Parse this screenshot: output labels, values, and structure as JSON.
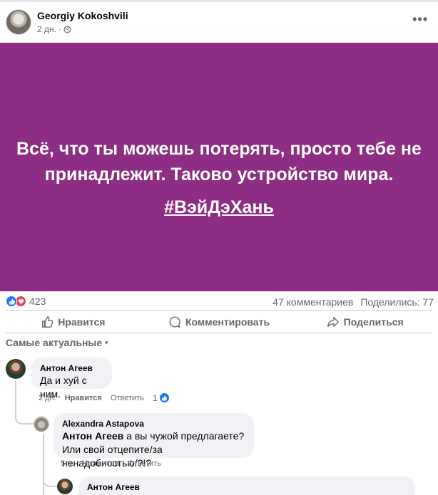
{
  "post": {
    "author": "Georgiy Kokoshvili",
    "time": "2 дн.",
    "separator": "·",
    "more": "•••",
    "privacy_icon": "globe-icon"
  },
  "banner": {
    "text": "Всё, что ты можешь потерять, просто тебе не принадлежит. Таково устройство мира.",
    "hashtag": "#ВэйДэХань",
    "background": "#8d2d83"
  },
  "stats": {
    "reaction_count": "423",
    "comments": "47 комментариев",
    "shares": "Поделились: 77"
  },
  "actions": {
    "like": "Нравится",
    "comment": "Комментировать",
    "share": "Поделиться"
  },
  "sort": {
    "label": "Самые актуальные",
    "caret": "▾"
  },
  "comments": [
    {
      "author": "Антон Агеев",
      "text": "Да и хуй с ним.",
      "time": "2 дн.",
      "like": "Нравится",
      "reply": "Ответить",
      "likes": "1"
    },
    {
      "author": "Alexandra Astapova",
      "mention": "Антон Агеев",
      "text": " а вы чужой предлагаете?",
      "text2": "Или свой отцепите/за ненадобностью/?!?",
      "time": "5 ч.",
      "like": "Нравится",
      "reply": "Ответить"
    },
    {
      "author": "Антон Агеев"
    }
  ],
  "colors": {
    "accent": "#1877f2",
    "love": "#f33e58",
    "muted": "#65676b",
    "bubble": "#f0f2f5"
  }
}
